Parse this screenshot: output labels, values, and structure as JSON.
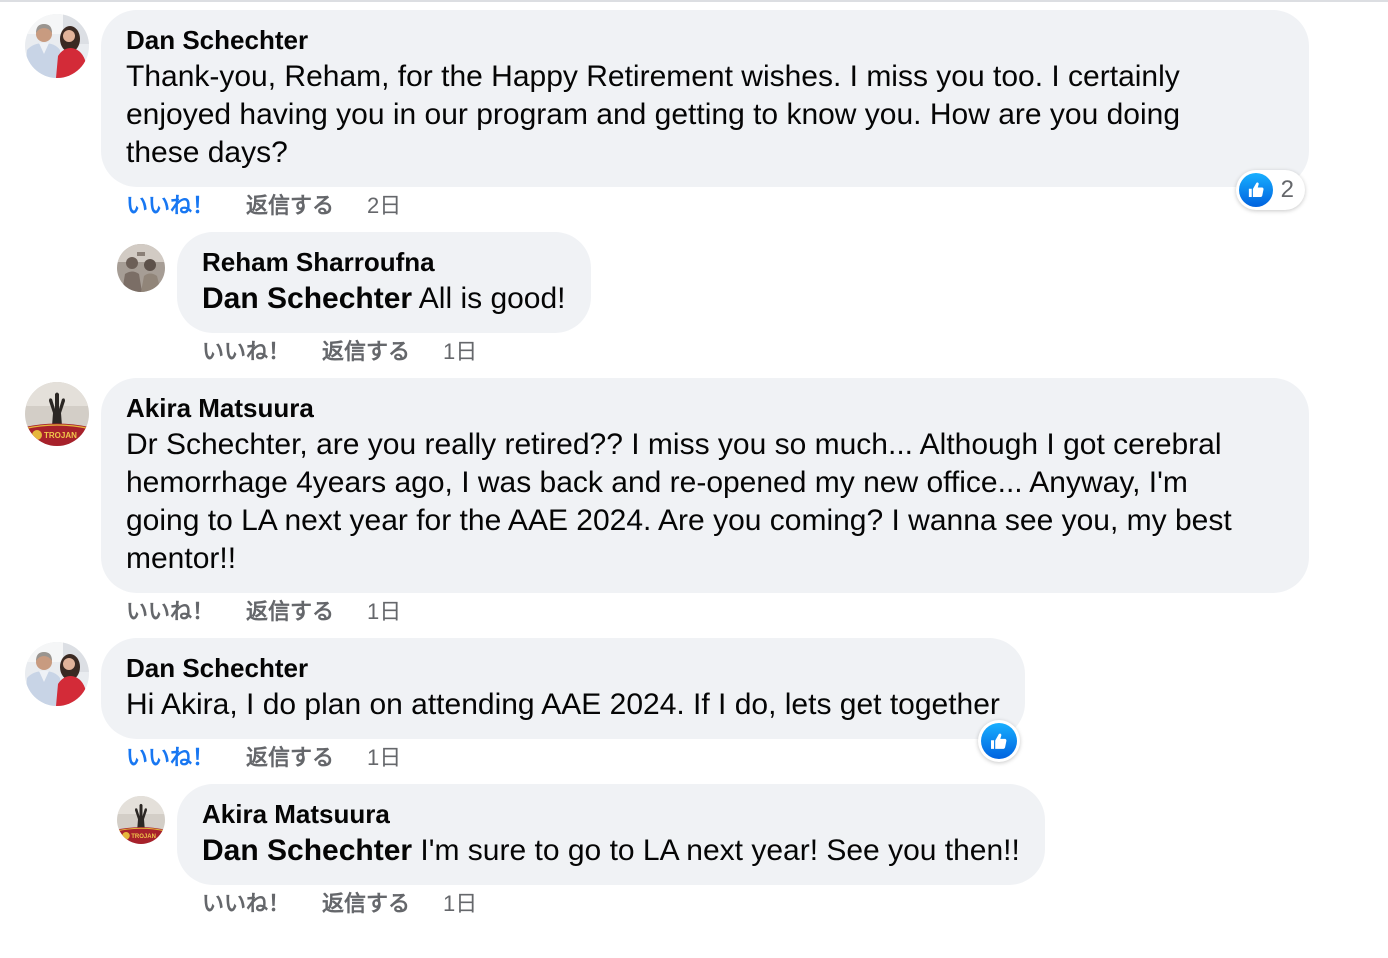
{
  "colors": {
    "bubble": "#f0f2f5",
    "text": "#050505",
    "secondary": "#65676b",
    "accent": "#1877f2"
  },
  "comments": [
    {
      "author": "Dan Schechter",
      "lines": [
        "Thank-you, Reham, for the Happy Retirement wishes. I miss you too. I certainly",
        "enjoyed having you in our program and getting to know you. How are you doing",
        "these days?"
      ],
      "actions": {
        "like": "いいね！",
        "reply": "返信する",
        "time": "2日"
      },
      "liked": true,
      "reactions": {
        "icon": "like-icon",
        "count": "2"
      },
      "replies": [
        {
          "author": "Reham Sharroufna",
          "mention": "Dan Schechter",
          "text": "All is good!",
          "actions": {
            "like": "いいね！",
            "reply": "返信する",
            "time": "1日"
          },
          "liked": false
        }
      ]
    },
    {
      "author": "Akira Matsuura",
      "avatar_text": "TROJAN",
      "lines": [
        "Dr Schechter, are you really retired?? I miss you so much... Although I got cerebral",
        "hemorrhage 4years ago, I was back and re-opened my new office... Anyway, I'm",
        "going to LA next year for the AAE 2024. Are you coming? I wanna see you, my best",
        "mentor!!"
      ],
      "actions": {
        "like": "いいね！",
        "reply": "返信する",
        "time": "1日"
      },
      "liked": false,
      "replies": []
    },
    {
      "author": "Dan Schechter",
      "lines": [
        "Hi Akira, I do plan on attending AAE 2024. If I do, lets get together"
      ],
      "actions": {
        "like": "いいね！",
        "reply": "返信する",
        "time": "1日"
      },
      "liked": true,
      "reactions": {
        "icon": "like-icon"
      },
      "replies": [
        {
          "author": "Akira Matsuura",
          "avatar_text": "TROJAN",
          "mention": "Dan Schechter",
          "text": "I'm sure to go to LA next year! See you then!!",
          "actions": {
            "like": "いいね！",
            "reply": "返信する",
            "time": "1日"
          },
          "liked": false
        }
      ]
    }
  ]
}
